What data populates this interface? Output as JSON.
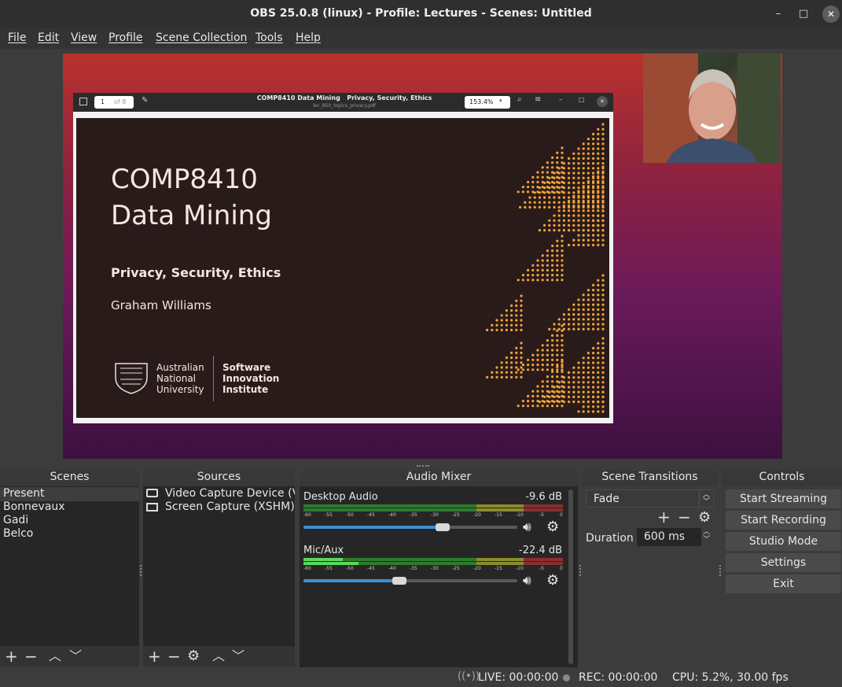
{
  "window": {
    "title": "OBS 25.0.8 (linux) - Profile: Lectures - Scenes: Untitled",
    "minimize": "–",
    "maximize": "□",
    "close": "✕"
  },
  "menu": [
    "File",
    "Edit",
    "View",
    "Profile",
    "Scene Collection",
    "Tools",
    "Help"
  ],
  "preview": {
    "pdf_viewer": {
      "page_number": "1",
      "page_total": "of 8",
      "doc_title": "COMP8410 Data Mining   Privacy, Security, Ethics",
      "file_name": "lec_850_topics_privacy.pdf",
      "zoom": "153.4%"
    },
    "slide": {
      "course": "COMP8410",
      "course_name": "Data Mining",
      "subtitle": "Privacy, Security, Ethics",
      "author": "Graham Williams",
      "uni_line1": "Australian",
      "uni_line2": "National",
      "uni_line3": "University",
      "sii_line1": "Software",
      "sii_line2": "Innovation",
      "sii_line3": "Institute"
    }
  },
  "docks": {
    "scenes": {
      "title": "Scenes",
      "items": [
        "Present",
        "Bonnevaux",
        "Gadi",
        "Belco"
      ]
    },
    "sources": {
      "title": "Sources",
      "items": [
        "Video Capture Device (V",
        "Screen Capture (XSHM)"
      ]
    },
    "audio_mixer": {
      "title": "Audio Mixer",
      "channels": [
        {
          "name": "Desktop Audio",
          "db": "-9.6 dB",
          "volume": 0.65
        },
        {
          "name": "Mic/Aux",
          "db": "-22.4 dB",
          "volume": 0.45
        }
      ],
      "ticks": [
        "-60",
        "-55",
        "-50",
        "-45",
        "-40",
        "-35",
        "-30",
        "-25",
        "-20",
        "-15",
        "-10",
        "-5",
        "0"
      ]
    },
    "transitions": {
      "title": "Scene Transitions",
      "selected": "Fade",
      "duration_label": "Duration",
      "duration_value": "600 ms"
    },
    "controls": {
      "title": "Controls",
      "buttons": [
        "Start Streaming",
        "Start Recording",
        "Studio Mode",
        "Settings",
        "Exit"
      ]
    }
  },
  "status": {
    "live": "LIVE: 00:00:00",
    "rec": "REC: 00:00:00",
    "cpu": "CPU: 5.2%, 30.00 fps"
  },
  "colors": {
    "accent_blue": "#3d8fd8",
    "meter_green": "#2e9b2e",
    "meter_yellow": "#9b9b2e",
    "meter_red": "#9b2e2e",
    "slide_dots": "#f2a53a",
    "slide_bg": "#2a1b1b"
  }
}
